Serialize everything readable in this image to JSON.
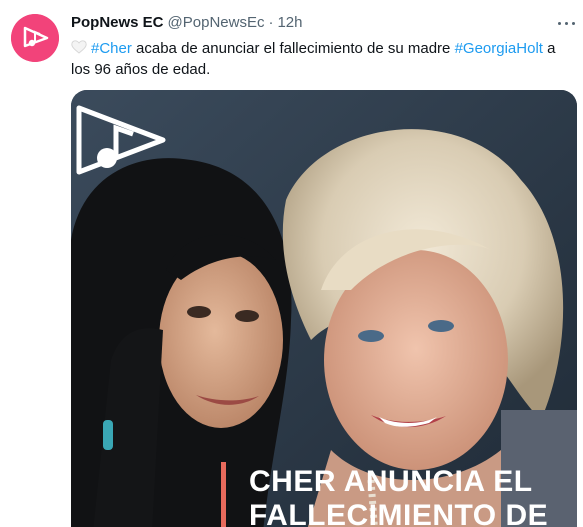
{
  "tweet": {
    "author_name": "PopNews EC",
    "author_handle": "@PopNewsEc",
    "separator": "·",
    "time": "12h",
    "text_part1": "acaba de anunciar el fallecimiento de su madre",
    "hashtag1": "#Cher",
    "hashtag2": "#GeorgiaHolt",
    "text_part2": "a los 96 años de edad.",
    "icons": {
      "avatar": "popnews-music-note-logo",
      "more": "more-dots-icon",
      "heart": "white-heart-icon"
    }
  },
  "media": {
    "alt": "Cher y Georgia Holt",
    "overlay_title": "CHER ANUNCIA EL FALLECIMIENTO DE",
    "colors": {
      "accent": "#e86a5c",
      "hashtag": "#1d9bf0",
      "avatar_bg": "#f2437a"
    }
  }
}
